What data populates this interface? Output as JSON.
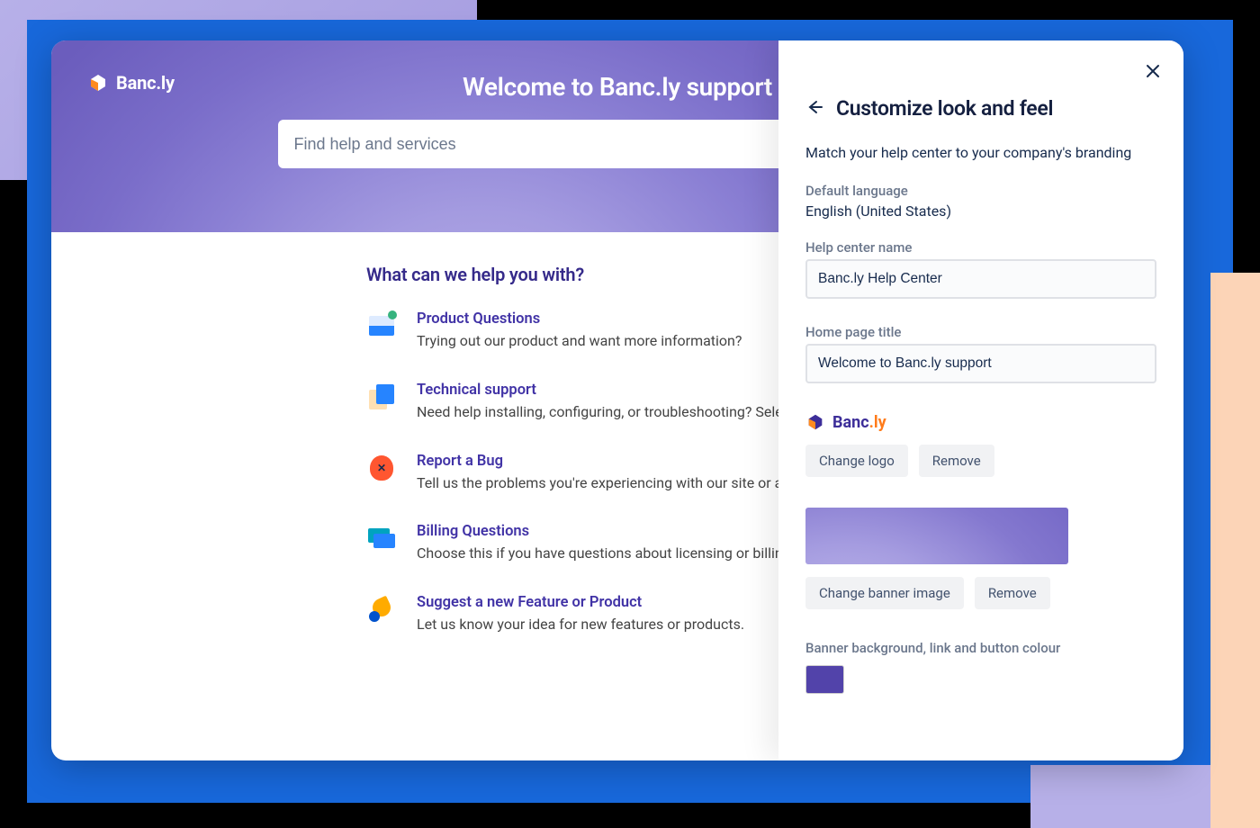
{
  "brand": {
    "name_prefix": "Banc",
    "name_suffix": ".ly"
  },
  "banner": {
    "title": "Welcome to Banc.ly support",
    "search_placeholder": "Find help and services"
  },
  "main": {
    "heading": "What can we help you with?",
    "topics": [
      {
        "title": "Product Questions",
        "desc": "Trying out our product and want more information?"
      },
      {
        "title": "Technical support",
        "desc": "Need help installing, configuring, or troubleshooting? Select this to"
      },
      {
        "title": "Report a Bug",
        "desc": "Tell us the problems you're experiencing with our site or app."
      },
      {
        "title": "Billing Questions",
        "desc": "Choose this if you have questions about licensing or billing."
      },
      {
        "title": "Suggest a new Feature or Product",
        "desc": "Let us know your idea for new features or products."
      }
    ]
  },
  "panel": {
    "title": "Customize look and feel",
    "subtitle": "Match your help center to your company's branding",
    "default_language_label": "Default language",
    "default_language_value": "English (United States)",
    "help_center_name_label": "Help center name",
    "help_center_name_value": "Banc.ly Help Center",
    "home_page_title_label": "Home page title",
    "home_page_title_value": "Welcome to Banc.ly support",
    "change_logo": "Change logo",
    "remove_logo": "Remove",
    "change_banner": "Change banner image",
    "remove_banner": "Remove",
    "color_label": "Banner background, link and button colour",
    "accent_color": "#5243aa"
  }
}
